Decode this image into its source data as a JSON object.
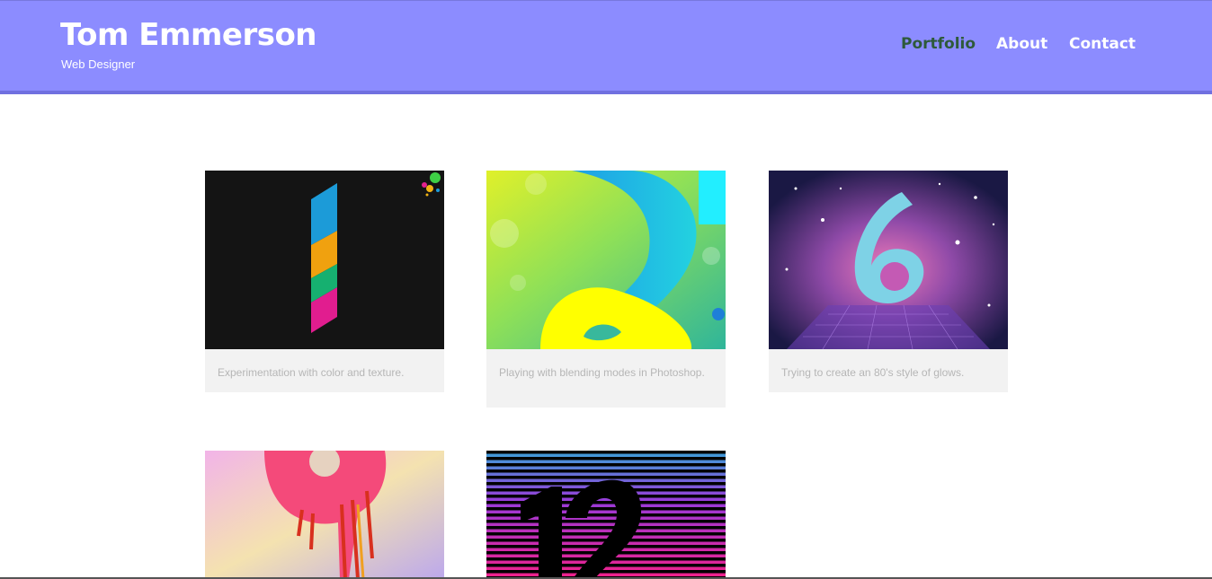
{
  "site": {
    "name": "Tom Emmerson",
    "tagline": "Web Designer"
  },
  "nav": {
    "items": [
      {
        "label": "Portfolio",
        "active": true
      },
      {
        "label": "About",
        "active": false
      },
      {
        "label": "Contact",
        "active": false
      }
    ]
  },
  "colors": {
    "header_bg": "#8c8cff",
    "header_border": "#7070e0",
    "nav_active": "#2e5a3a",
    "caption_bg": "#f2f2f2",
    "caption_text": "#b6b6b6"
  },
  "portfolio": {
    "items": [
      {
        "image": "striped-number-1-artwork",
        "caption": "Experimentation with color and texture."
      },
      {
        "image": "neon-number-2-artwork",
        "caption": "Playing with blending modes in Photoshop."
      },
      {
        "image": "glowing-number-6-artwork",
        "caption": "Trying to create an 80's style of glows."
      },
      {
        "image": "dripping-number-9-artwork",
        "caption": ""
      },
      {
        "image": "striped-number-12-artwork",
        "caption": ""
      }
    ]
  }
}
